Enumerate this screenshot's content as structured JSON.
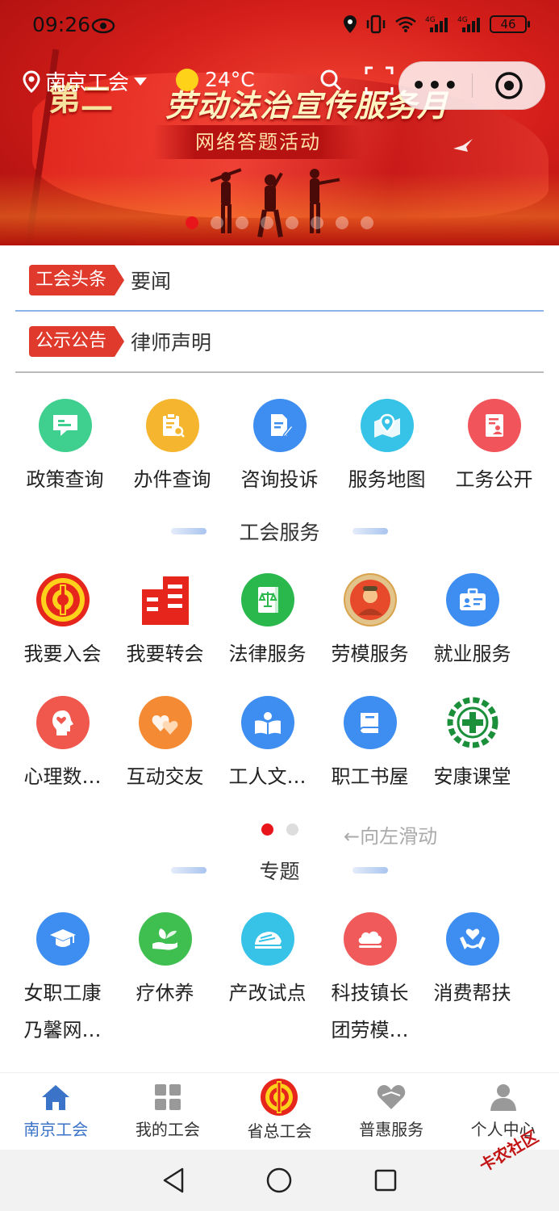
{
  "status_bar": {
    "time": "09:26",
    "battery": "46",
    "signal_labels": [
      "4G",
      "4G"
    ]
  },
  "banner": {
    "prefix_text": "第二",
    "title": "劳动法治宣传服务月",
    "subtitle": "网络答题活动",
    "slide_count": 8,
    "active_slide": 0
  },
  "header": {
    "location": "南京工会",
    "temperature": "24°C"
  },
  "news": [
    {
      "tag": "工会头条",
      "text": "要闻"
    },
    {
      "tag": "公示公告",
      "text": "律师声明"
    }
  ],
  "quick_services": [
    {
      "label": "政策查询",
      "icon": "chat-icon",
      "color": "#3fcf8f"
    },
    {
      "label": "办件查询",
      "icon": "clipboard-search-icon",
      "color": "#f5b52e"
    },
    {
      "label": "咨询投诉",
      "icon": "edit-document-icon",
      "color": "#3d8ef0"
    },
    {
      "label": "服务地图",
      "icon": "map-pin-icon",
      "color": "#37c3e8"
    },
    {
      "label": "工务公开",
      "icon": "document-person-icon",
      "color": "#f2545b"
    }
  ],
  "union_services": {
    "title": "工会服务",
    "items": [
      {
        "label": "我要入会",
        "icon": "union-emblem-icon",
        "color": "#e6261c"
      },
      {
        "label": "我要转会",
        "icon": "building-icon",
        "color": "#e6261c"
      },
      {
        "label": "法律服务",
        "icon": "law-book-icon",
        "color": "#2ab84c"
      },
      {
        "label": "劳模服务",
        "icon": "medal-portrait-icon",
        "color": "#d9a24c"
      },
      {
        "label": "就业服务",
        "icon": "briefcase-icon",
        "color": "#3d8ef0"
      },
      {
        "label": "心理数…",
        "icon": "head-heart-icon",
        "color": "#f0584e"
      },
      {
        "label": "互动交友",
        "icon": "hearts-icon",
        "color": "#f58a34"
      },
      {
        "label": "工人文…",
        "icon": "open-book-icon",
        "color": "#3d8ef0"
      },
      {
        "label": "职工书屋",
        "icon": "book-icon",
        "color": "#3d8ef0"
      },
      {
        "label": "安康课堂",
        "icon": "health-cross-gear-icon",
        "color": "#1b8f3a"
      }
    ],
    "page_count": 2,
    "active_page": 0,
    "swipe_hint": "←向左滑动"
  },
  "topics": {
    "title": "专题",
    "items": [
      {
        "label": "女职工康",
        "label2": "乃馨网…",
        "icon": "graduation-cap-icon",
        "color": "#3d8ef0"
      },
      {
        "label": "疗休养",
        "label2": "",
        "icon": "leaf-hand-icon",
        "color": "#3fbf4f"
      },
      {
        "label": "产改试点",
        "label2": "",
        "icon": "train-icon",
        "color": "#37c3e8"
      },
      {
        "label": "科技镇长",
        "label2": "团劳模…",
        "icon": "cloud-icon",
        "color": "#f05a5a"
      },
      {
        "label": "消费帮扶",
        "label2": "",
        "icon": "heart-hands-icon",
        "color": "#3d8ef0"
      }
    ]
  },
  "tabbar": [
    {
      "label": "南京工会",
      "icon": "home-icon",
      "active": true
    },
    {
      "label": "我的工会",
      "icon": "grid-icon",
      "active": false
    },
    {
      "label": "省总工会",
      "icon": "union-emblem-icon",
      "active": false
    },
    {
      "label": "普惠服务",
      "icon": "heart-icon",
      "active": false
    },
    {
      "label": "个人中心",
      "icon": "person-icon",
      "active": false
    }
  ],
  "watermark": "卡农社区",
  "colors": {
    "accent_red": "#e8161a",
    "tab_active": "#3a73c7",
    "divider_blue": "#8ab4ea"
  }
}
